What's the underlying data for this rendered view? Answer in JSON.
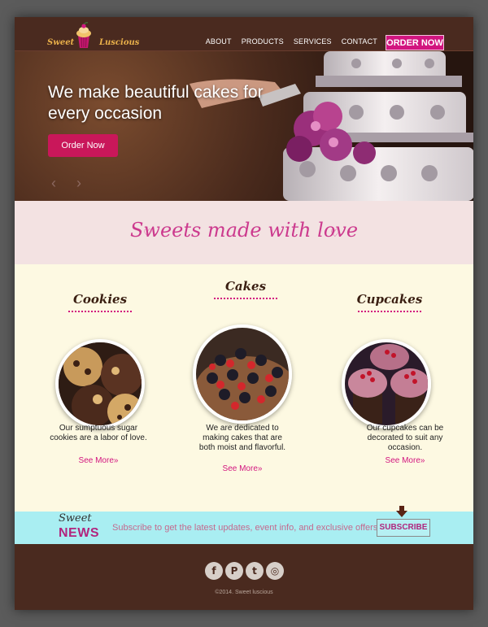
{
  "header": {
    "logo_left": "Sweet",
    "logo_right": "Luscious",
    "nav": [
      "ABOUT",
      "PRODUCTS",
      "SERVICES",
      "CONTACT"
    ],
    "order_button": "ORDER NOW"
  },
  "hero": {
    "title": "We make beautiful cakes for every occasion",
    "button": "Order Now",
    "prev_arrow": "‹",
    "next_arrow": "›"
  },
  "tagline": {
    "text": "Sweets made with love",
    "heart": "♡"
  },
  "products": [
    {
      "title": "Cookies",
      "description": "Our sumptuous sugar cookies are a labor of love.",
      "link": "See More»"
    },
    {
      "title": "Cakes",
      "description": "We are dedicated to making cakes that are both moist and flavorful.",
      "link": "See More»"
    },
    {
      "title": "Cupcakes",
      "description": "Our cupcakes can be decorated to suit any occasion.",
      "link": "See More»"
    }
  ],
  "newsletter": {
    "sweet": "Sweet",
    "news": "NEWS",
    "text": "Subscribe to get the latest updates, event info, and exclusive offers!",
    "button": "SUBSCRIBE"
  },
  "footer": {
    "social": [
      {
        "icon": "facebook-icon",
        "glyph": "f"
      },
      {
        "icon": "pinterest-icon",
        "glyph": "P"
      },
      {
        "icon": "twitter-icon",
        "glyph": "t"
      },
      {
        "icon": "instagram-icon",
        "glyph": "◎"
      }
    ],
    "copyright": "©2014. Sweet luscious"
  },
  "colors": {
    "brand_brown": "#4a2a1f",
    "accent_pink": "#d2157f",
    "tagline_bg": "#f3e2e2",
    "products_bg": "#fdf9e2",
    "newsletter_bg": "#a9eef2"
  }
}
